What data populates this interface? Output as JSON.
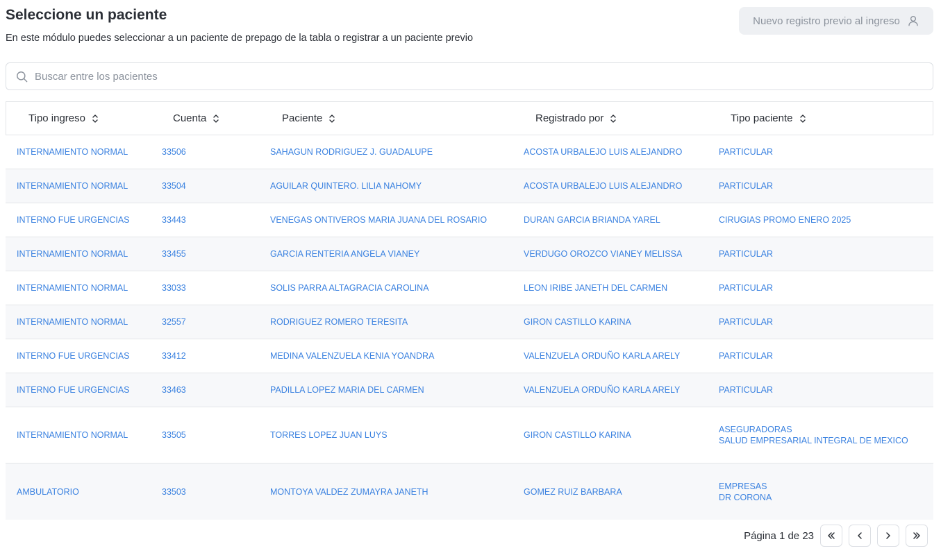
{
  "header": {
    "title": "Seleccione un paciente",
    "subtitle": "En este módulo puedes seleccionar a un paciente de prepago de la tabla o registrar a un paciente previo",
    "new_button_label": "Nuevo registro previo al ingreso"
  },
  "search": {
    "placeholder": "Buscar entre los pacientes",
    "value": ""
  },
  "table": {
    "columns": [
      "Tipo ingreso",
      "Cuenta",
      "Paciente",
      "Registrado por",
      "Tipo paciente"
    ],
    "rows": [
      {
        "tipo_ingreso": "INTERNAMIENTO NORMAL",
        "cuenta": "33506",
        "paciente": "SAHAGUN RODRIGUEZ J. GUADALUPE",
        "registrado_por": "ACOSTA URBALEJO LUIS ALEJANDRO",
        "tipo_paciente": "PARTICULAR",
        "tipo_paciente_2": ""
      },
      {
        "tipo_ingreso": "INTERNAMIENTO NORMAL",
        "cuenta": "33504",
        "paciente": "AGUILAR QUINTERO. LILIA NAHOMY",
        "registrado_por": "ACOSTA URBALEJO LUIS ALEJANDRO",
        "tipo_paciente": "PARTICULAR",
        "tipo_paciente_2": ""
      },
      {
        "tipo_ingreso": "INTERNO FUE URGENCIAS",
        "cuenta": "33443",
        "paciente": "VENEGAS ONTIVEROS MARIA JUANA DEL ROSARIO",
        "registrado_por": "DURAN GARCIA BRIANDA YAREL",
        "tipo_paciente": "CIRUGIAS PROMO ENERO 2025",
        "tipo_paciente_2": ""
      },
      {
        "tipo_ingreso": "INTERNAMIENTO NORMAL",
        "cuenta": "33455",
        "paciente": "GARCIA RENTERIA ANGELA VIANEY",
        "registrado_por": "VERDUGO OROZCO VIANEY MELISSA",
        "tipo_paciente": "PARTICULAR",
        "tipo_paciente_2": ""
      },
      {
        "tipo_ingreso": "INTERNAMIENTO NORMAL",
        "cuenta": "33033",
        "paciente": "SOLIS PARRA ALTAGRACIA CAROLINA",
        "registrado_por": "LEON IRIBE JANETH DEL CARMEN",
        "tipo_paciente": "PARTICULAR",
        "tipo_paciente_2": ""
      },
      {
        "tipo_ingreso": "INTERNAMIENTO NORMAL",
        "cuenta": "32557",
        "paciente": "RODRIGUEZ ROMERO TERESITA",
        "registrado_por": "GIRON CASTILLO KARINA",
        "tipo_paciente": "PARTICULAR",
        "tipo_paciente_2": ""
      },
      {
        "tipo_ingreso": "INTERNO FUE URGENCIAS",
        "cuenta": "33412",
        "paciente": "MEDINA VALENZUELA KENIA YOANDRA",
        "registrado_por": "VALENZUELA ORDUÑO KARLA ARELY",
        "tipo_paciente": "PARTICULAR",
        "tipo_paciente_2": ""
      },
      {
        "tipo_ingreso": "INTERNO FUE URGENCIAS",
        "cuenta": "33463",
        "paciente": "PADILLA LOPEZ MARIA DEL CARMEN",
        "registrado_por": "VALENZUELA ORDUÑO KARLA ARELY",
        "tipo_paciente": "PARTICULAR",
        "tipo_paciente_2": ""
      },
      {
        "tipo_ingreso": "INTERNAMIENTO NORMAL",
        "cuenta": "33505",
        "paciente": "TORRES LOPEZ JUAN LUYS",
        "registrado_por": "GIRON CASTILLO KARINA",
        "tipo_paciente": "ASEGURADORAS",
        "tipo_paciente_2": "SALUD EMPRESARIAL INTEGRAL DE MEXICO"
      },
      {
        "tipo_ingreso": "AMBULATORIO",
        "cuenta": "33503",
        "paciente": "MONTOYA VALDEZ ZUMAYRA JANETH",
        "registrado_por": "GOMEZ RUIZ BARBARA",
        "tipo_paciente": "EMPRESAS",
        "tipo_paciente_2": "DR CORONA"
      }
    ]
  },
  "pagination": {
    "label": "Página 1 de 23"
  },
  "icons": {
    "new_button": "user-icon",
    "search": "search-icon",
    "sort": "sort-icon",
    "first": "chevrons-left-icon",
    "prev": "chevron-left-icon",
    "next": "chevron-right-icon",
    "last": "chevrons-right-icon"
  },
  "colors": {
    "link": "#3b82e0",
    "row_alt": "#f7f8fa",
    "border": "#e3e5e8",
    "button_bg": "#eef0f3",
    "muted": "#8b929c",
    "text": "#2b2f36"
  }
}
